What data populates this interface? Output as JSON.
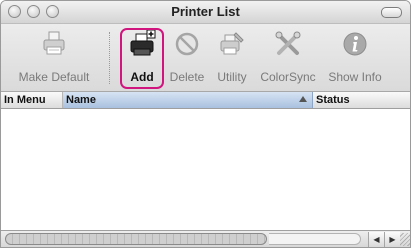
{
  "window": {
    "title": "Printer List"
  },
  "toolbar": {
    "items": [
      {
        "label": "Make Default",
        "icon": "printer-default-icon"
      },
      {
        "label": "Add",
        "icon": "add-printer-icon"
      },
      {
        "label": "Delete",
        "icon": "delete-icon"
      },
      {
        "label": "Utility",
        "icon": "utility-icon"
      },
      {
        "label": "ColorSync",
        "icon": "colorsync-icon"
      },
      {
        "label": "Show Info",
        "icon": "info-icon"
      }
    ],
    "highlight_color": "#d0157e"
  },
  "table": {
    "columns": [
      "In Menu",
      "Name",
      "Status"
    ],
    "sorted_column": "Name",
    "rows": []
  },
  "scrollbar": {
    "left_arrow": "◀",
    "right_arrow": "▶"
  }
}
